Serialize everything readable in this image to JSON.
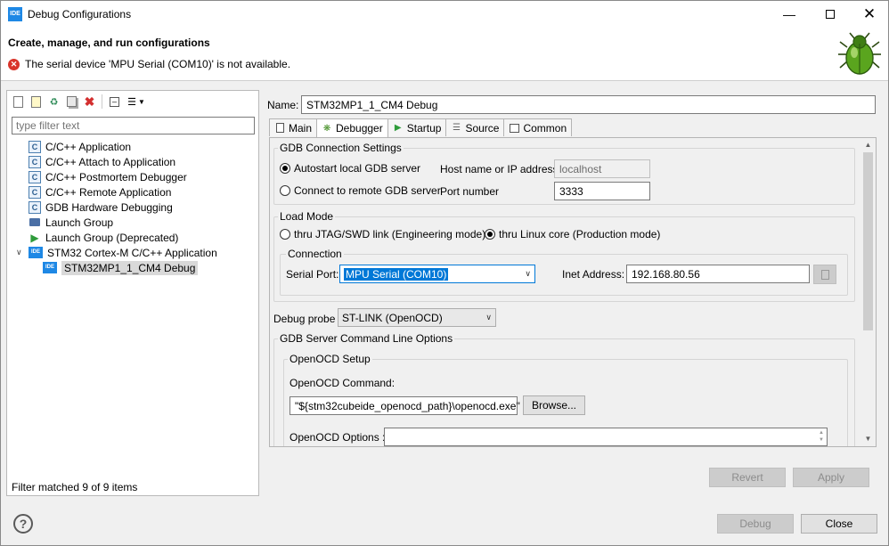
{
  "window": {
    "title": "Debug Configurations",
    "app_icon": "IDE"
  },
  "header": {
    "title": "Create, manage, and run configurations",
    "error_message": "The serial device 'MPU Serial (COM10)' is not available."
  },
  "left": {
    "filter_placeholder": "type filter text",
    "tree": [
      {
        "label": "C/C++ Application",
        "icon": "c-icon",
        "glyph": "C"
      },
      {
        "label": "C/C++ Attach to Application",
        "icon": "c-icon",
        "glyph": "C"
      },
      {
        "label": "C/C++ Postmortem Debugger",
        "icon": "c-icon",
        "glyph": "C"
      },
      {
        "label": "C/C++ Remote Application",
        "icon": "c-icon",
        "glyph": "C"
      },
      {
        "label": "GDB Hardware Debugging",
        "icon": "c-icon",
        "glyph": "C"
      },
      {
        "label": "Launch Group",
        "icon": "launch-group-icon"
      },
      {
        "label": "Launch Group (Deprecated)",
        "icon": "launch-icon"
      },
      {
        "label": "STM32 Cortex-M C/C++ Application",
        "icon": "ide-icon",
        "glyph": "IDE"
      },
      {
        "label": "STM32MP1_1_CM4 Debug",
        "icon": "ide-icon",
        "glyph": "IDE"
      }
    ],
    "status": "Filter matched 9 of 9 items"
  },
  "config": {
    "name_label": "Name:",
    "name_value": "STM32MP1_1_CM4 Debug",
    "tabs": [
      {
        "label": "Main",
        "icon": "main-tab-icon"
      },
      {
        "label": "Debugger",
        "icon": "debugger-tab-icon"
      },
      {
        "label": "Startup",
        "icon": "startup-tab-icon"
      },
      {
        "label": "Source",
        "icon": "source-tab-icon"
      },
      {
        "label": "Common",
        "icon": "common-tab-icon"
      }
    ],
    "gdb_connection": {
      "title": "GDB Connection Settings",
      "autostart_label": "Autostart local GDB server",
      "remote_label": "Connect to remote GDB server",
      "host_label": "Host name or IP address",
      "host_value": "localhost",
      "port_label": "Port number",
      "port_value": "3333"
    },
    "load_mode": {
      "title": "Load Mode",
      "jtag_label": "thru JTAG/SWD link (Engineering mode)",
      "linux_label": "thru Linux core (Production mode)",
      "connection_title": "Connection",
      "serial_port_label": "Serial Port:",
      "serial_port_value": "MPU Serial (COM10)",
      "inet_label": "Inet Address:",
      "inet_value": "192.168.80.56"
    },
    "debug_probe_label": "Debug probe",
    "debug_probe_value": "ST-LINK (OpenOCD)",
    "gdb_server": {
      "title": "GDB Server Command Line Options",
      "openocd_setup_title": "OpenOCD Setup",
      "command_label": "OpenOCD Command:",
      "command_value": "\"${stm32cubeide_openocd_path}\\openocd.exe\"",
      "browse_label": "Browse...",
      "options_label": "OpenOCD Options :"
    }
  },
  "buttons": {
    "revert": "Revert",
    "apply": "Apply",
    "debug": "Debug",
    "close": "Close"
  }
}
